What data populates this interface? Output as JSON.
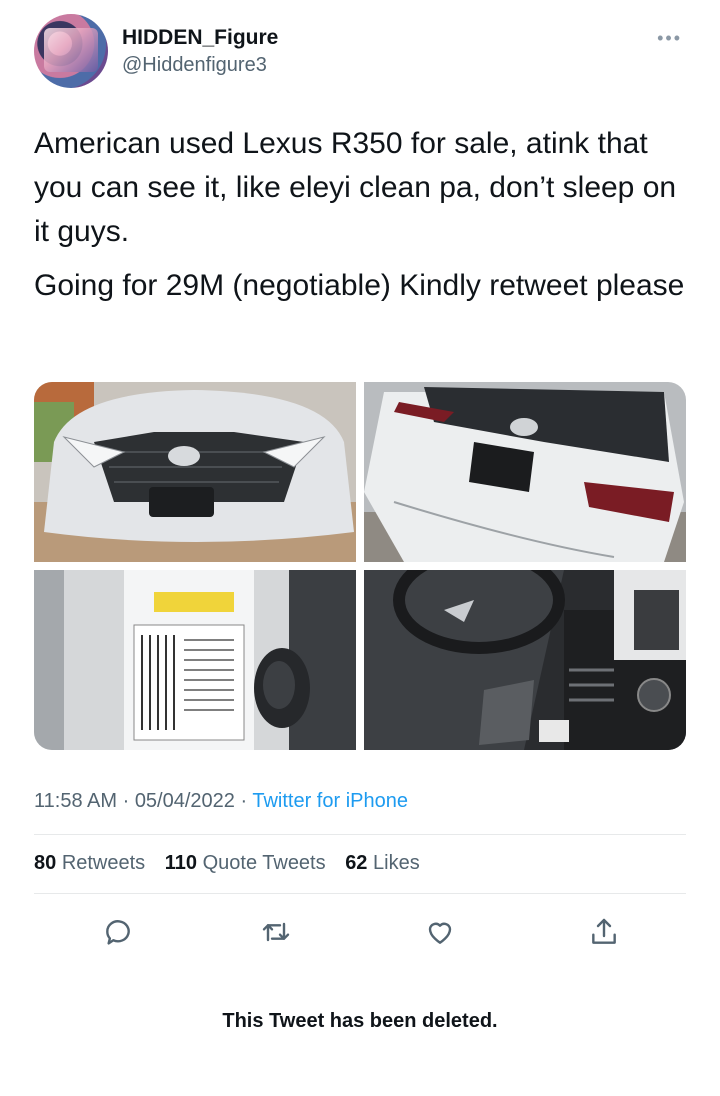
{
  "author": {
    "display_name": "HIDDEN_Figure",
    "handle": "@Hiddenfigure3",
    "avatar_icon": "profile-avatar",
    "more_icon": "more-dots-icon"
  },
  "tweet": {
    "paragraphs": [
      "American used Lexus R350 for sale, atink that you can see it, like eleyi clean pa, don’t sleep on it guys.",
      "Going for 29M (negotiable) Kindly retweet please"
    ],
    "media": [
      {
        "alt": "front-of-car-photo"
      },
      {
        "alt": "rear-of-car-photo"
      },
      {
        "alt": "door-sticker-photo"
      },
      {
        "alt": "interior-dashboard-photo"
      }
    ]
  },
  "meta": {
    "time": "11:58 AM",
    "separator": " · ",
    "date": "05/04/2022",
    "source": "Twitter for iPhone"
  },
  "stats": {
    "retweets_count": "80",
    "retweets_label": "Retweets",
    "quotes_count": "110",
    "quotes_label": "Quote Tweets",
    "likes_count": "62",
    "likes_label": "Likes"
  },
  "actions": [
    "reply-icon",
    "retweet-icon",
    "like-icon",
    "share-icon"
  ],
  "notice": "This Tweet has been deleted.",
  "colors": {
    "link": "#1d9bf0",
    "secondary_text": "#536471",
    "primary_text": "#0f1419"
  }
}
